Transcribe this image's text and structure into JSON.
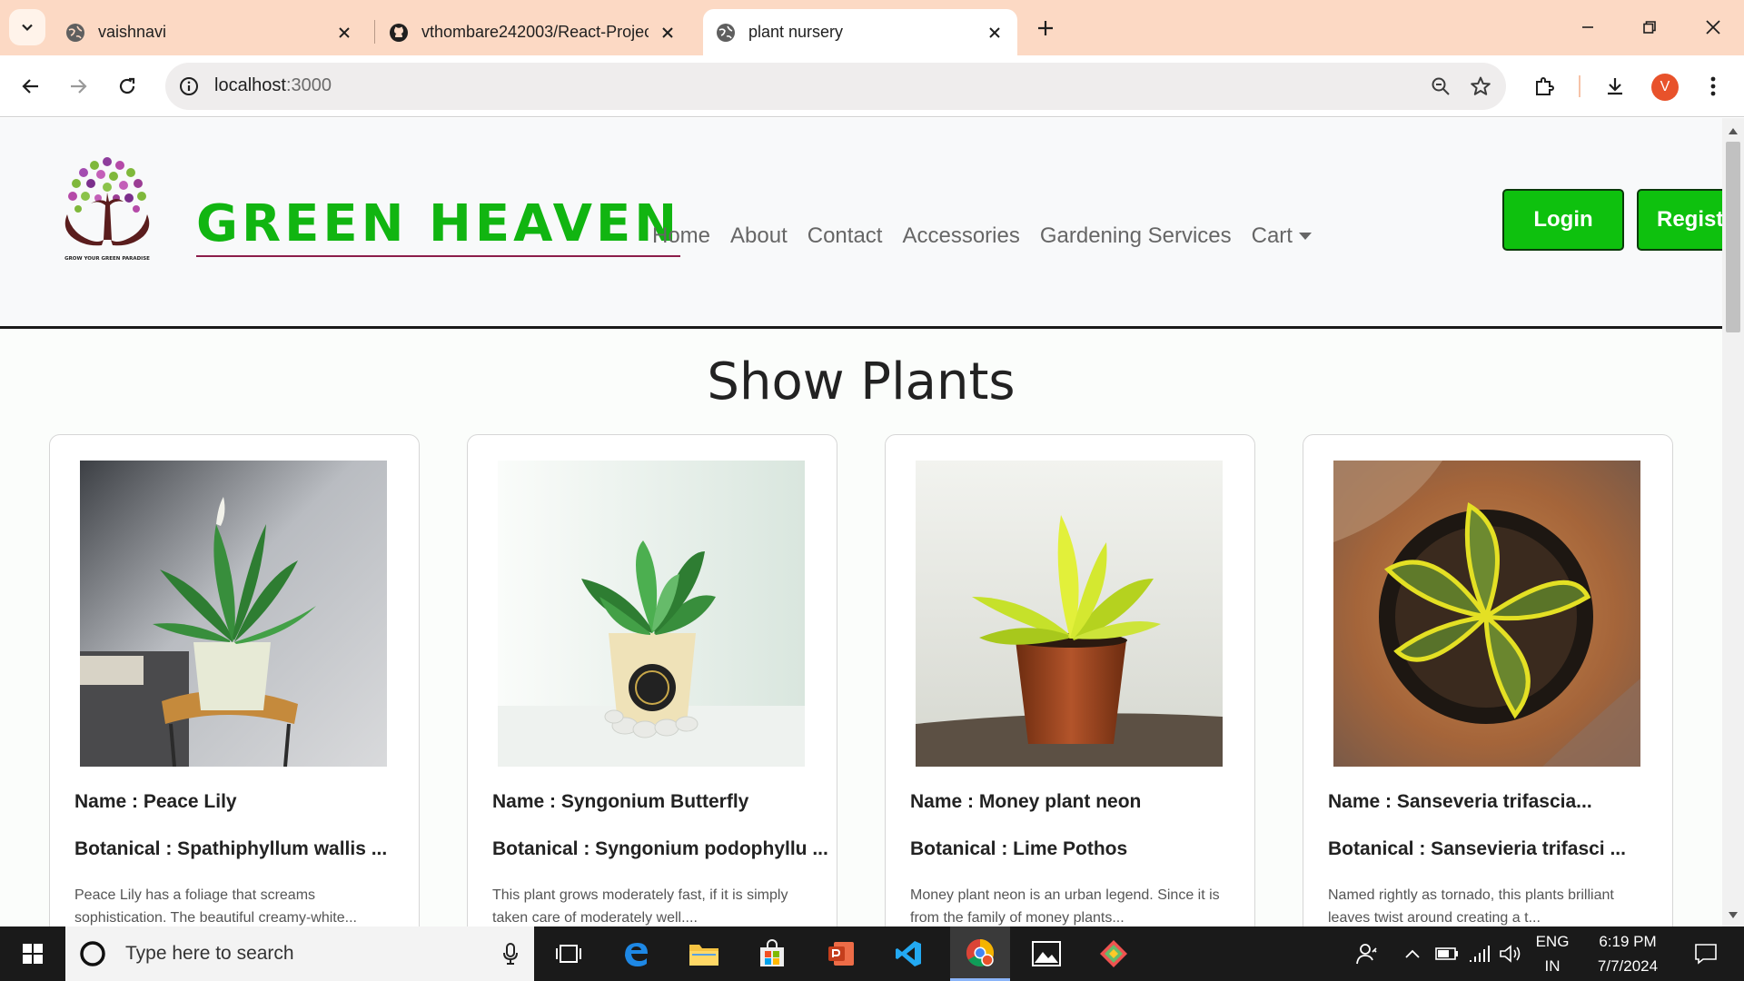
{
  "browser": {
    "tabs": [
      {
        "label": "vaishnavi",
        "active": false
      },
      {
        "label": "vthombare242003/React-Projec",
        "active": false
      },
      {
        "label": "plant nursery",
        "active": true
      }
    ],
    "url_host": "localhost",
    "url_port": ":3000",
    "profile_initial": "V",
    "accent": "#fcd9c4"
  },
  "site": {
    "brand": "GREEN HEAVEN",
    "logo_tagline": "GROW YOUR GREEN PARADISE",
    "brand_color": "#11b511",
    "nav": [
      {
        "label": "Home"
      },
      {
        "label": "About"
      },
      {
        "label": "Contact"
      },
      {
        "label": "Accessories"
      },
      {
        "label": "Gardening Services"
      },
      {
        "label": "Cart",
        "dropdown": true
      }
    ],
    "login_label": "Login",
    "register_label": "Regist",
    "button_color": "#0ec10e"
  },
  "page": {
    "title": "Show Plants",
    "plants": [
      {
        "name": "Name : Peace Lily",
        "botanical": "Botanical : Spathiphyllum wallis ...",
        "description": "Peace Lily has a foliage that screams sophistication. The beautiful creamy-white..."
      },
      {
        "name": "Name : Syngonium Butterfly",
        "botanical": "Botanical : Syngonium podophyllu ...",
        "description": "This plant grows moderately fast, if it is simply taken care of moderately well...."
      },
      {
        "name": "Name : Money plant neon",
        "botanical": "Botanical : Lime Pothos",
        "description": "Money plant neon is an urban legend. Since it is from the family of money plants..."
      },
      {
        "name": "Name : Sanseveria trifascia...",
        "botanical": "Botanical : Sansevieria trifasci ...",
        "description": "Named rightly as tornado, this plants brilliant leaves twist around creating a t..."
      }
    ]
  },
  "taskbar": {
    "search_placeholder": "Type here to search",
    "lang_top": "ENG",
    "lang_bottom": "IN",
    "time": "6:19 PM",
    "date": "7/7/2024"
  }
}
